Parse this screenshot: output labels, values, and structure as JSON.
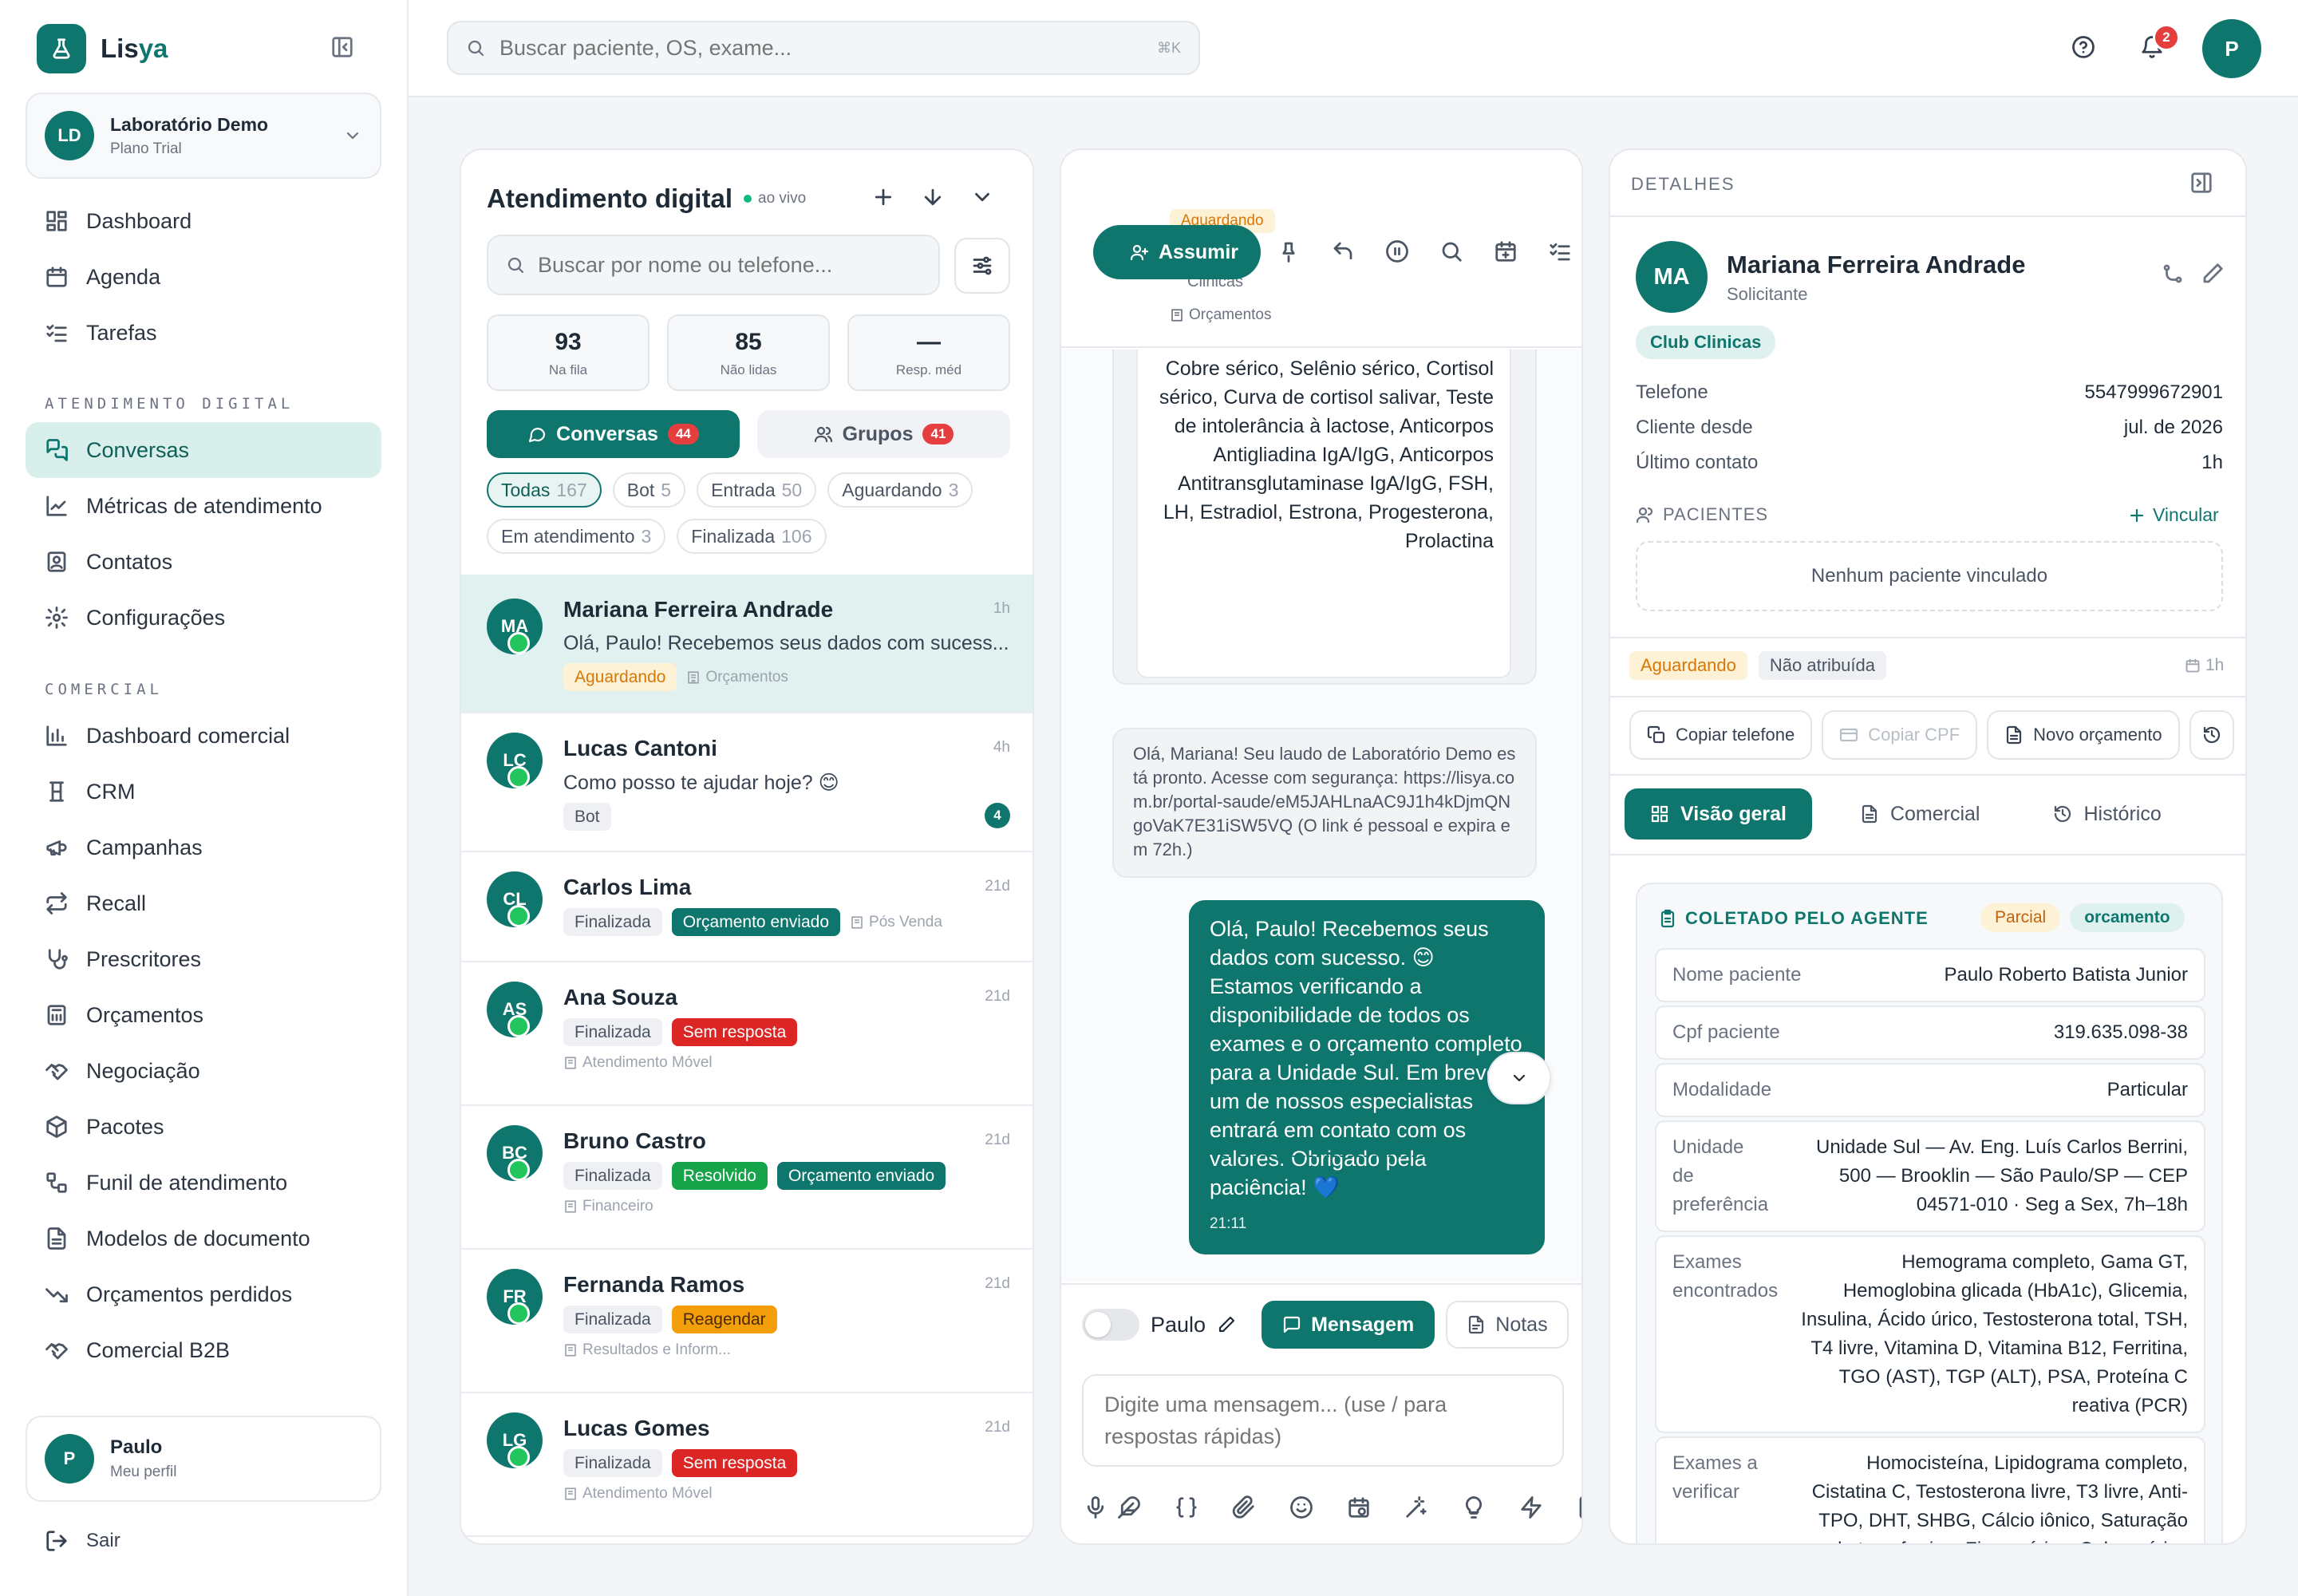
{
  "brand": {
    "name_a": "Lis",
    "name_b": "ya"
  },
  "org": {
    "initials": "LD",
    "name": "Laboratório Demo",
    "plan": "Plano Trial"
  },
  "nav": {
    "main": [
      {
        "label": "Dashboard"
      },
      {
        "label": "Agenda"
      },
      {
        "label": "Tarefas"
      }
    ],
    "section_atendimento": "ATENDIMENTO DIGITAL",
    "atendimento": [
      {
        "label": "Conversas"
      },
      {
        "label": "Métricas de atendimento"
      },
      {
        "label": "Contatos"
      },
      {
        "label": "Configurações"
      }
    ],
    "section_comercial": "COMERCIAL",
    "comercial": [
      {
        "label": "Dashboard comercial"
      },
      {
        "label": "CRM"
      },
      {
        "label": "Campanhas"
      },
      {
        "label": "Recall"
      },
      {
        "label": "Prescritores"
      },
      {
        "label": "Orçamentos"
      },
      {
        "label": "Negociação"
      },
      {
        "label": "Pacotes"
      },
      {
        "label": "Funil de atendimento"
      },
      {
        "label": "Modelos de documento"
      },
      {
        "label": "Orçamentos perdidos"
      },
      {
        "label": "Comercial B2B"
      }
    ]
  },
  "profile": {
    "initial": "P",
    "name": "Paulo",
    "sub": "Meu perfil"
  },
  "logout": "Sair",
  "topbar": {
    "search_placeholder": "Buscar paciente, OS, exame...",
    "shortcut": "⌘K",
    "notif_count": "2",
    "avatar": "P"
  },
  "conversations": {
    "title": "Atendimento digital",
    "live": "ao vivo",
    "search_placeholder": "Buscar por nome ou telefone...",
    "stats": [
      {
        "value": "93",
        "label": "Na fila"
      },
      {
        "value": "85",
        "label": "Não lidas"
      },
      {
        "value": "—",
        "label": "Resp. méd"
      }
    ],
    "tab_conversas": "Conversas",
    "tab_conversas_count": "44",
    "tab_grupos": "Grupos",
    "tab_grupos_count": "41",
    "filters": [
      {
        "label": "Todas",
        "n": "167"
      },
      {
        "label": "Bot",
        "n": "5"
      },
      {
        "label": "Entrada",
        "n": "50"
      },
      {
        "label": "Aguardando",
        "n": "3"
      },
      {
        "label": "Em atendimento",
        "n": "3"
      },
      {
        "label": "Finalizada",
        "n": "106"
      }
    ],
    "items": [
      {
        "initials": "MA",
        "name": "Mariana Ferreira Andrade",
        "time": "1h",
        "msg": "Olá, Paulo! Recebemos seus dados com sucess...",
        "tags": [
          "Aguardando"
        ],
        "meta": "Orçamentos"
      },
      {
        "initials": "LC",
        "name": "Lucas Cantoni",
        "time": "4h",
        "msg": "Como posso te ajudar hoje? 😊",
        "tags": [
          "Bot"
        ],
        "unread": "4"
      },
      {
        "initials": "CL",
        "name": "Carlos Lima",
        "time": "21d",
        "tags": [
          "Finalizada",
          "Orçamento enviado"
        ],
        "meta": "Pós Venda"
      },
      {
        "initials": "AS",
        "name": "Ana Souza",
        "time": "21d",
        "tags": [
          "Finalizada",
          "Sem resposta"
        ],
        "meta": "Atendimento Móvel"
      },
      {
        "initials": "BC",
        "name": "Bruno Castro",
        "time": "21d",
        "tags": [
          "Finalizada",
          "Resolvido",
          "Orçamento enviado"
        ],
        "meta": "Financeiro"
      },
      {
        "initials": "FR",
        "name": "Fernanda Ramos",
        "time": "21d",
        "tags": [
          "Finalizada",
          "Reagendar"
        ],
        "meta": "Resultados e Inform..."
      },
      {
        "initials": "LG",
        "name": "Lucas Gomes",
        "time": "21d",
        "tags": [
          "Finalizada",
          "Sem resposta"
        ],
        "meta": "Atendimento Móvel"
      }
    ]
  },
  "chat": {
    "status": "Aguardando",
    "clinic": "Clinicas",
    "channel": "Orçamentos",
    "assumir": "Assumir",
    "exam_card": "Cobre sérico, Selênio sérico, Cortisol sérico, Curva de cortisol salivar, Teste de intolerância à lactose, Anticorpos Antigliadina IgA/IgG, Anticorpos Antitransglutaminase IgA/IgG, FSH, LH, Estradiol, Estrona, Progesterona, Prolactina",
    "laudo_msg": "Olá, Mariana! Seu laudo de Laboratório Demo está pronto. Acesse com segurança: https://lisya.com.br/portal-saude/eM5JAHLnaAC9J1h4kDjmQNgoVaK7E31iSW5VQ (O link é pessoal e expira em 72h.)",
    "out_msg": "Olá, Paulo! Recebemos seus dados com sucesso. 😊 Estamos verificando a disponibilidade de todos os exames e o orçamento completo para a Unidade Sul. Em breve um de nossos especialistas entrará em contato com os valores. Obrigado pela paciência! 💙",
    "out_time": "21:11",
    "composer": {
      "agent": "Paulo",
      "mode_msg": "Mensagem",
      "mode_notes": "Notas",
      "placeholder": "Digite uma mensagem... (use / para respostas rápidas)"
    }
  },
  "details": {
    "title": "DETALHES",
    "patient": {
      "initials": "MA",
      "name": "Mariana Ferreira Andrade",
      "role": "Solicitante",
      "club": "Club Clinicas"
    },
    "info": [
      {
        "k": "Telefone",
        "v": "5547999672901"
      },
      {
        "k": "Cliente desde",
        "v": "jul. de 2026"
      },
      {
        "k": "Último contato",
        "v": "1h"
      }
    ],
    "pacientes_title": "PACIENTES",
    "vincular": "Vincular",
    "no_patient": "Nenhum paciente vinculado",
    "status": "Aguardando",
    "assign": "Não atribuída",
    "since": "1h",
    "actions": [
      "Copiar telefone",
      "Copiar CPF",
      "Novo orçamento"
    ],
    "tabs": [
      "Visão geral",
      "Comercial",
      "Histórico"
    ],
    "collected": {
      "title": "COLETADO PELO AGENTE",
      "badge1": "Parcial",
      "badge2": "orcamento",
      "fields": [
        {
          "k": "Nome paciente",
          "v": "Paulo Roberto Batista Junior"
        },
        {
          "k": "Cpf paciente",
          "v": "319.635.098-38"
        },
        {
          "k": "Modalidade",
          "v": "Particular"
        },
        {
          "k": "Unidade de preferência",
          "v": "Unidade Sul — Av. Eng. Luís Carlos Berrini, 500 — Brooklin — São Paulo/SP — CEP 04571-010 · Seg a Sex, 7h–18h"
        },
        {
          "k": "Exames encontrados",
          "v": "Hemograma completo, Gama GT, Hemoglobina glicada (HbA1c), Glicemia, Insulina, Ácido úrico, Testosterona total, TSH, T4 livre, Vitamina D, Vitamina B12, Ferritina, TGO (AST), TGP (ALT), PSA, Proteína C reativa (PCR)"
        },
        {
          "k": "Exames a verificar",
          "v": "Homocisteína, Lipidograma completo, Cistatina C, Testosterona livre, T3 livre, Anti-TPO, DHT, SHBG, Cálcio iônico, Saturação da transferrina, Zinco sérico, Cobre sérico"
        }
      ]
    }
  },
  "colors": {
    "primary": "#0f766e",
    "accent_light": "#d8efec",
    "danger": "#dc2626",
    "warning": "#d97706"
  }
}
